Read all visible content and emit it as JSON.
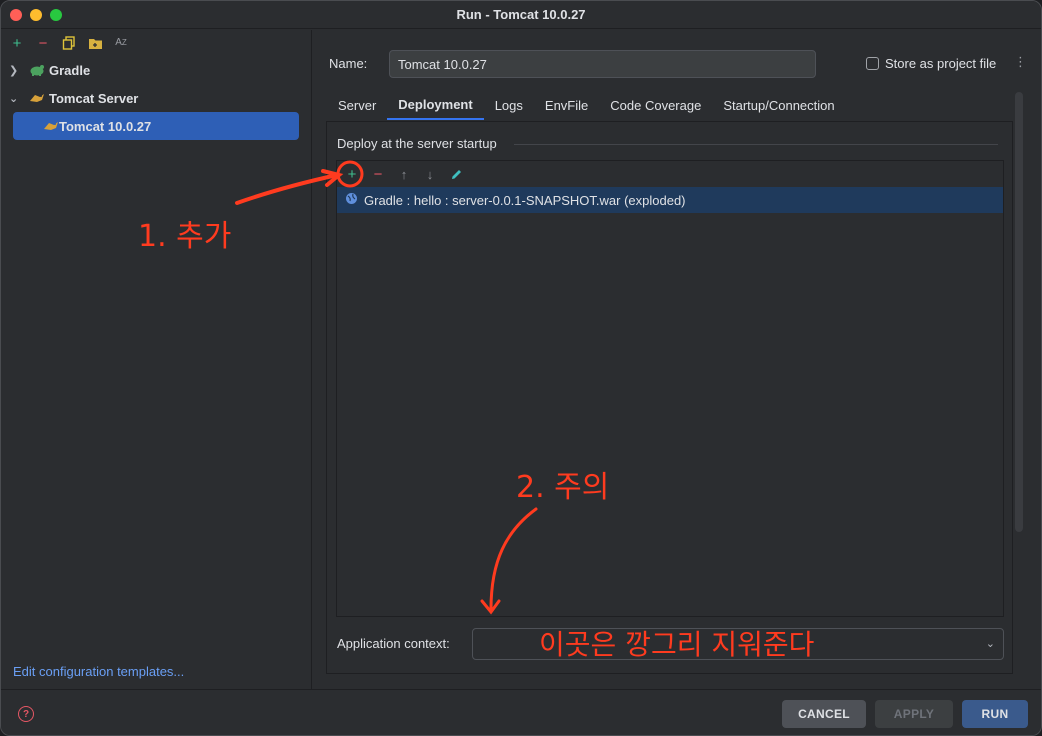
{
  "window": {
    "title": "Run - Tomcat 10.0.27"
  },
  "sidebar": {
    "toolbar": [
      {
        "icon": "add-icon",
        "glyph": "+",
        "color": "#3fbf8f"
      },
      {
        "icon": "remove-icon",
        "glyph": "−",
        "color": "#e55765"
      },
      {
        "icon": "copy-icon",
        "glyph": "⧉",
        "color": "#dfc43a"
      },
      {
        "icon": "new-folder-icon",
        "glyph": "▣",
        "color": "#d7b140"
      },
      {
        "icon": "sort-icon",
        "glyph": "AZ",
        "color": "#9a9da3"
      }
    ],
    "items": [
      {
        "label": "Gradle",
        "expanded": false
      },
      {
        "label": "Tomcat Server",
        "expanded": true
      },
      {
        "label": "Tomcat 10.0.27",
        "selected": true
      }
    ],
    "edit_templates": "Edit configuration templates..."
  },
  "config": {
    "name_label": "Name:",
    "name_value": "Tomcat 10.0.27",
    "store_as_project_file": "Store as project file",
    "store_checked": false
  },
  "tabs": [
    "Server",
    "Deployment",
    "Logs",
    "EnvFile",
    "Code Coverage",
    "Startup/Connection"
  ],
  "active_tab": "Deployment",
  "deployment": {
    "section_title": "Deploy at the server startup",
    "artifacts": [
      "Gradle : hello : server-0.0.1-SNAPSHOT.war (exploded)"
    ],
    "app_context_label": "Application context:",
    "app_context_value": ""
  },
  "footer": {
    "cancel": "CANCEL",
    "apply": "APPLY",
    "run": "RUN"
  },
  "annotations": {
    "add_note": "1. 추가",
    "warning_note": "2. 주의",
    "clear_note": "이곳은 깡그리 지워준다"
  },
  "colors": {
    "accent": "#3574f0",
    "selected_row": "#2e5fb6",
    "annotation_red": "#ff3b1f"
  }
}
